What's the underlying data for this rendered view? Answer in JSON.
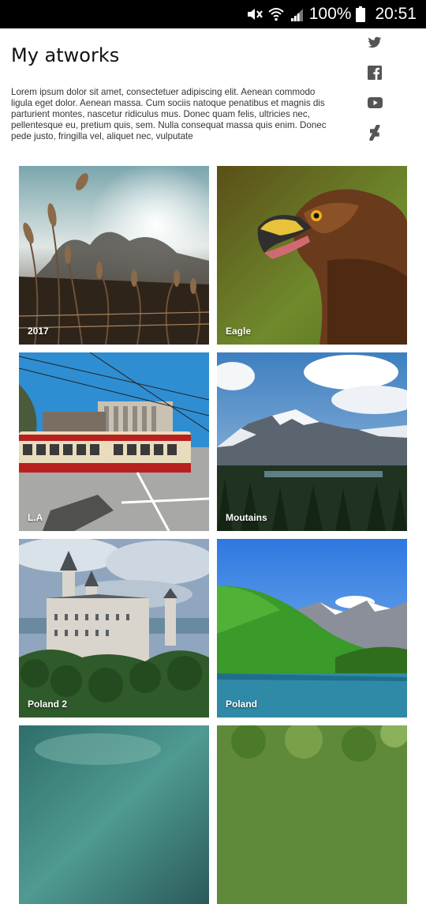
{
  "status_bar": {
    "battery_percent": "100%",
    "time": "20:51",
    "icons": [
      "mute-icon",
      "wifi-icon",
      "signal-icon",
      "battery-icon"
    ]
  },
  "page": {
    "title": "My atworks",
    "description": "Lorem ipsum dolor sit amet, consectetuer adipiscing elit. Aenean commodo ligula eget dolor. Aenean massa. Cum sociis natoque penatibus et magnis dis parturient montes, nascetur ridiculus mus. Donec quam felis, ultricies nec, pellentesque eu, pretium quis, sem. Nulla consequat massa quis enim. Donec pede justo, fringilla vel, aliquet nec, vulputate"
  },
  "social_links": [
    "twitter-icon",
    "facebook-icon",
    "youtube-icon",
    "deviantart-icon"
  ],
  "gallery": [
    {
      "caption": "2017",
      "scene": "grass-sunset"
    },
    {
      "caption": "Eagle",
      "scene": "eagle"
    },
    {
      "caption": "L.A",
      "scene": "streetcar"
    },
    {
      "caption": "Moutains",
      "scene": "mountains"
    },
    {
      "caption": "Poland 2",
      "scene": "castle"
    },
    {
      "caption": "Poland",
      "scene": "alpine-lake"
    },
    {
      "caption": "",
      "scene": "teal-texture"
    },
    {
      "caption": "",
      "scene": "aerial-forest"
    }
  ],
  "colors": {
    "status_bar_bg": "#000000",
    "page_bg": "#ffffff",
    "title_text": "#111111",
    "social_icon": "#555555"
  }
}
